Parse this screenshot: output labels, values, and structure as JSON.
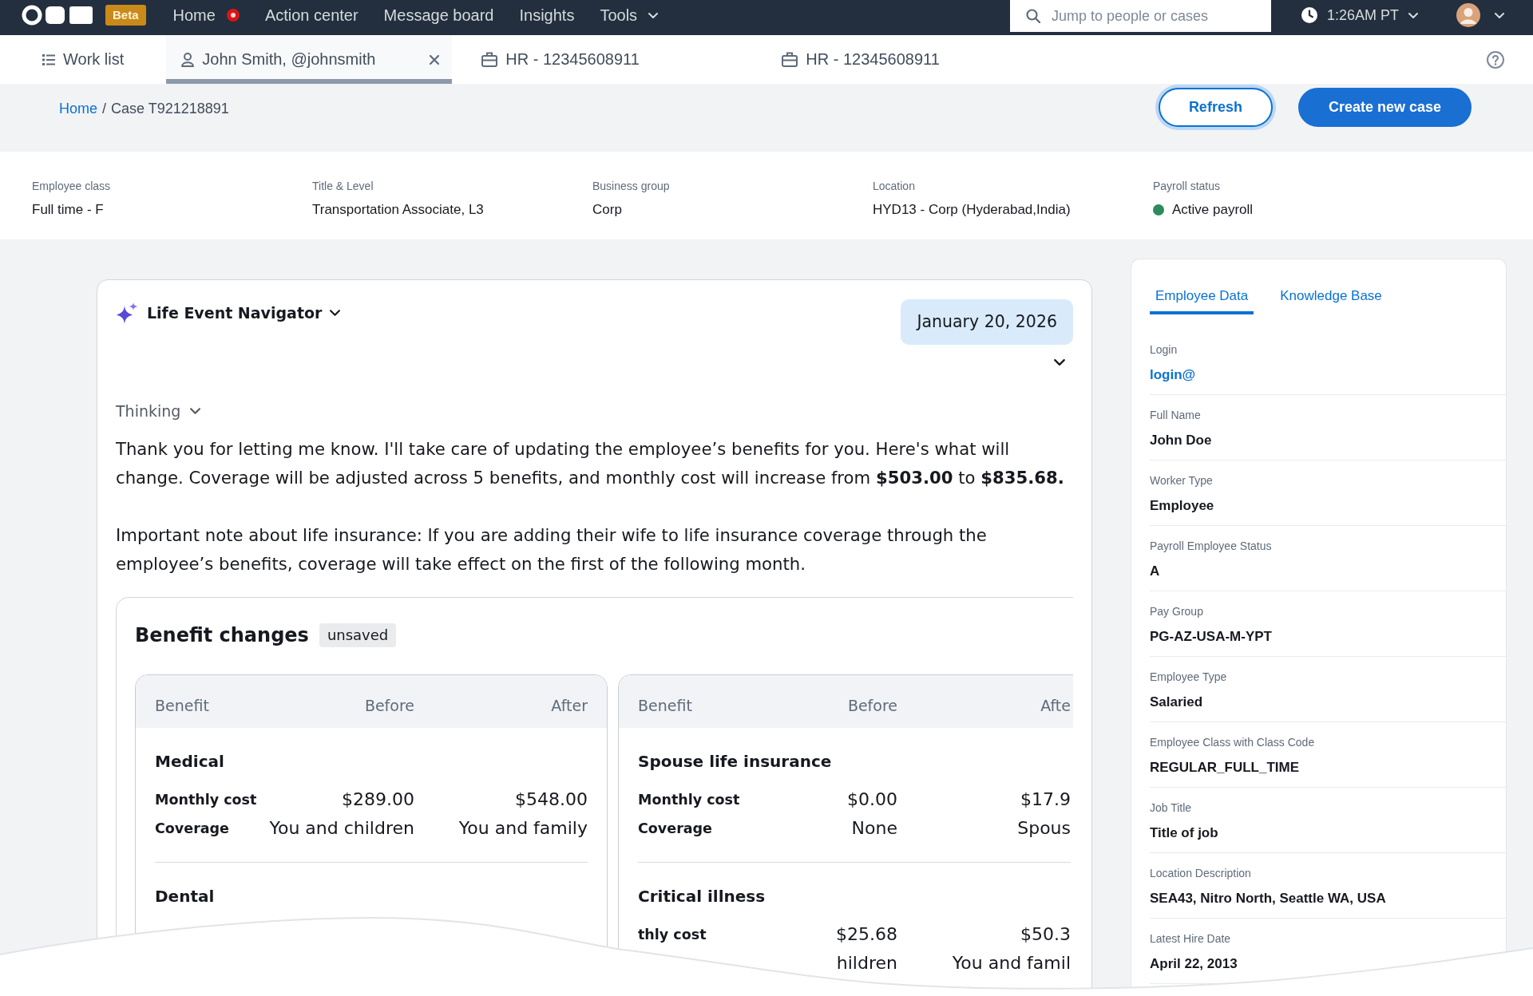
{
  "top_nav": {
    "badge": "Beta",
    "items": [
      {
        "label": "Home",
        "notification": true,
        "has_dropdown": false
      },
      {
        "label": "Action center",
        "notification": false,
        "has_dropdown": false
      },
      {
        "label": "Message board",
        "notification": false,
        "has_dropdown": false
      },
      {
        "label": "Insights",
        "notification": false,
        "has_dropdown": false
      },
      {
        "label": "Tools",
        "notification": false,
        "has_dropdown": true
      }
    ],
    "search": {
      "placeholder": "Jump to people or cases"
    },
    "time": "1:26AM PT"
  },
  "work_tabs": [
    {
      "kind": "worklist",
      "label": "Work list",
      "selected": false,
      "closable": false
    },
    {
      "kind": "employee",
      "label": "John Smith, @johnsmith",
      "selected": true,
      "closable": true
    },
    {
      "kind": "case",
      "label": "HR - 12345608911",
      "selected": false,
      "closable": false
    },
    {
      "kind": "case",
      "label": "HR - 12345608911",
      "selected": false,
      "closable": false
    }
  ],
  "breadcrumb": {
    "separator": "/",
    "items": [
      {
        "label": "Home",
        "link": true
      },
      {
        "label": "Case T921218891",
        "link": false
      }
    ]
  },
  "actions": [
    {
      "kind": "secondary",
      "label": "Refresh",
      "focused": true
    },
    {
      "kind": "primary",
      "label": "Create new case",
      "focused": false
    }
  ],
  "employee_summary": [
    {
      "label": "Employee class",
      "value": "Full time - F"
    },
    {
      "label": "Title & Level",
      "value": "Transportation Associate, L3"
    },
    {
      "label": "Business group",
      "value": "Corp"
    },
    {
      "label": "Location",
      "value": "HYD13 - Corp (Hyderabad,India)"
    },
    {
      "label": "Payroll status",
      "value": "Active payroll",
      "color": "#2d8a5f"
    }
  ],
  "assistant": {
    "title": "Life Event Navigator",
    "user_message": "January 20, 2026",
    "thinking": {
      "label": "Thinking",
      "expanded": false
    },
    "response": [
      "Thank you for letting me know. I'll take care of updating the employee’s benefits for you. Here's what will change. Coverage will be adjusted across 5 benefits, and monthly cost will increase from **$503.00** to **$835.68.**",
      "Important note about life insurance: If you are adding their wife to life insurance coverage through the employee’s benefits, coverage will take effect on the first of the following month."
    ],
    "benefit_changes": {
      "title": "Benefit changes",
      "badge": "unsaved",
      "tables": [
        {
          "columns": [
            "Benefit",
            "Before",
            "After"
          ],
          "benefits": [
            {
              "name": "Medical",
              "rows": [
                {
                  "label": "Monthly cost",
                  "before": "$289.00",
                  "after": "$548.00"
                },
                {
                  "label": "Coverage",
                  "before": "You and children",
                  "after": "You and family"
                }
              ]
            },
            {
              "name": "Dental"
            }
          ]
        },
        {
          "columns": [
            "Benefit",
            "Before",
            "Afte"
          ],
          "benefits": [
            {
              "name": "Spouse life insurance",
              "rows": [
                {
                  "label": "Monthly cost",
                  "before": "$0.00",
                  "after": "$17.9"
                },
                {
                  "label": "Coverage",
                  "before": "None",
                  "after": "Spous"
                }
              ]
            },
            {
              "name": "Critical illness",
              "rows": [
                {
                  "label": "thly cost",
                  "before": "$25.68",
                  "after": "$50.3"
                },
                {
                  "before": "hildren",
                  "after": "You and famil"
                }
              ]
            }
          ]
        }
      ]
    }
  },
  "side_panel": {
    "tabs": [
      {
        "label": "Employee Data",
        "selected": true
      },
      {
        "label": "Knowledge Base",
        "selected": false
      }
    ],
    "fields": [
      {
        "label": "Login",
        "value": "login@",
        "link": true
      },
      {
        "label": "Full Name",
        "value": "John Doe",
        "link": false
      },
      {
        "label": "Worker Type",
        "value": "Employee",
        "link": false
      },
      {
        "label": "Payroll Employee Status",
        "value": "A",
        "link": false
      },
      {
        "label": "Pay Group",
        "value": "PG-AZ-USA-M-YPT",
        "link": false
      },
      {
        "label": "Employee Type",
        "value": "Salaried",
        "link": false
      },
      {
        "label": "Employee Class with Class Code",
        "value": "REGULAR_FULL_TIME",
        "link": false
      },
      {
        "label": "Job Title",
        "value": "Title of job",
        "link": false
      },
      {
        "label": "Location Description",
        "value": "SEA43, Nitro North, Seattle WA, USA",
        "link": false
      },
      {
        "label": "Latest Hire Date",
        "value": "April 22, 2013",
        "link": false
      }
    ]
  }
}
